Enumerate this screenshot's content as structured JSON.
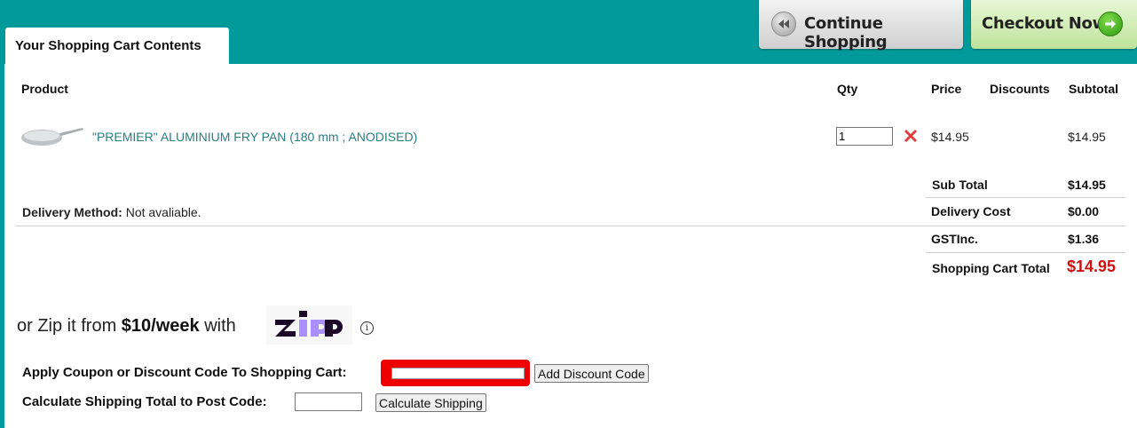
{
  "header": {
    "tab_title": "Your Shopping Cart Contents",
    "continue_label": "Continue Shopping",
    "checkout_label": "Checkout Now"
  },
  "table": {
    "headers": {
      "product": "Product",
      "qty": "Qty",
      "price": "Price",
      "discounts": "Discounts",
      "subtotal": "Subtotal"
    },
    "item": {
      "name": "\"PREMIER\" ALUMINIUM FRY PAN (180 mm ; ANODISED)",
      "qty": "1",
      "price": "$14.95",
      "subtotal": "$14.95",
      "image_icon": "fry-pan-image"
    }
  },
  "delivery": {
    "label": "Delivery Method:",
    "value": "Not avaliable."
  },
  "totals": {
    "sub_total_label": "Sub Total",
    "sub_total": "$14.95",
    "delivery_label": "Delivery Cost",
    "delivery": "$0.00",
    "gst_label": "GSTInc.",
    "gst": "$1.36",
    "cart_total_label": "Shopping Cart Total",
    "cart_total": "$14.95",
    "cart_total_color": "#cc1111"
  },
  "zip": {
    "prefix": "or Zip it from ",
    "amount": "$10/week",
    "suffix": " with",
    "logo_text": "zip"
  },
  "coupon": {
    "label": "Apply Coupon or Discount Code To Shopping Cart:",
    "value": "",
    "button": "Add Discount Code"
  },
  "shipping": {
    "label": "Calculate Shipping Total to Post Code:",
    "value": "",
    "button": "Calculate Shipping"
  },
  "colors": {
    "teal": "#009a9a",
    "link": "#2a7f80",
    "highlight": "#ee0000"
  }
}
